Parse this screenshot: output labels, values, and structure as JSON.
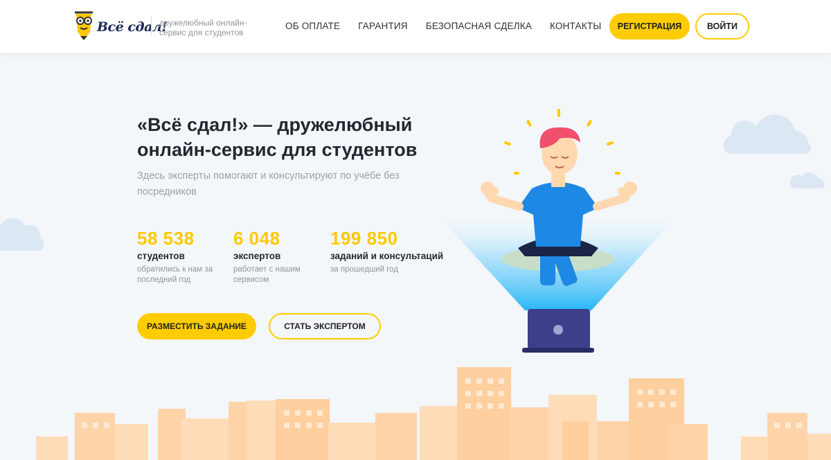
{
  "header": {
    "logo_text": "Всё сдал!",
    "tagline": "дружелюбный онлайн-сервис для студентов",
    "nav": [
      {
        "label": "Об оплате"
      },
      {
        "label": "Гарантия"
      },
      {
        "label": "Безопасная сделка"
      },
      {
        "label": "Контакты"
      }
    ],
    "register_label": "Регистрация",
    "login_label": "Войти"
  },
  "hero": {
    "title": "«Всё сдал!» — дружелюбный онлайн-сервис для студентов",
    "subtitle": "Здесь эксперты помогают и консультируют по учёбе без посредников",
    "stats": [
      {
        "number": "58 538",
        "label": "студентов",
        "desc": "обратились к нам за последний год"
      },
      {
        "number": "6 048",
        "label": "экспертов",
        "desc": "работает с нашим сервисом"
      },
      {
        "number": "199 850",
        "label": "заданий и консультаций",
        "desc": "за прошедший год"
      }
    ],
    "primary_button": "Разместить задание",
    "secondary_button": "Стать экспертом"
  },
  "colors": {
    "accent": "#ffcc00",
    "background": "#f3f7fa",
    "text_dark": "#222831",
    "text_muted": "#9aa1a8",
    "skyline": "#ffd0a3"
  },
  "icons": [
    "mascot-logo-icon",
    "cloud-icon",
    "meditating-student-illustration",
    "laptop-icon",
    "city-skyline-illustration"
  ]
}
